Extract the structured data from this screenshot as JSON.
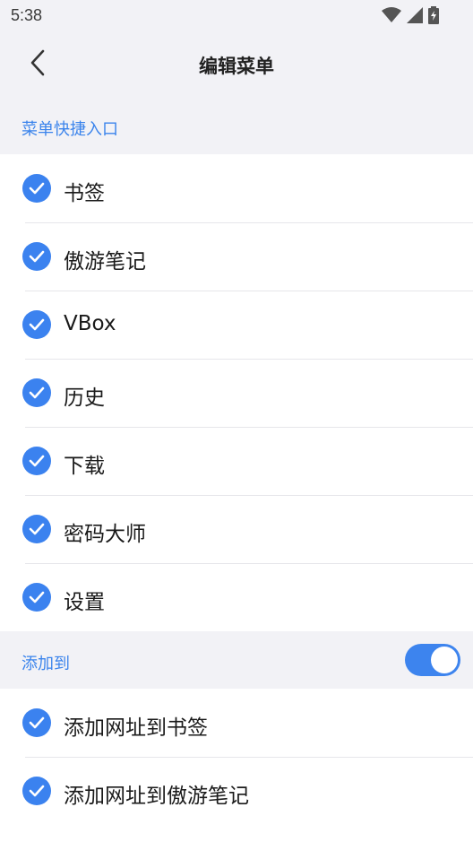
{
  "status_bar": {
    "time": "5:38",
    "icons": [
      "wifi-icon",
      "signal-icon",
      "battery-icon"
    ]
  },
  "nav": {
    "title": "编辑菜单",
    "back_icon": "chevron-left-icon"
  },
  "menu_section": {
    "title": "菜单快捷入口",
    "items": [
      {
        "label": "书签",
        "checked": true
      },
      {
        "label": "傲游笔记",
        "checked": true
      },
      {
        "label": "VBox",
        "checked": true
      },
      {
        "label": "历史",
        "checked": true
      },
      {
        "label": "下载",
        "checked": true
      },
      {
        "label": "密码大师",
        "checked": true
      },
      {
        "label": "设置",
        "checked": true
      }
    ]
  },
  "add_section": {
    "title": "添加到",
    "toggle_on": true,
    "items": [
      {
        "label": "添加网址到书签",
        "checked": true
      },
      {
        "label": "添加网址到傲游笔记",
        "checked": true
      }
    ]
  },
  "colors": {
    "accent": "#3b84ec",
    "background_grey": "#f2f2f6"
  }
}
